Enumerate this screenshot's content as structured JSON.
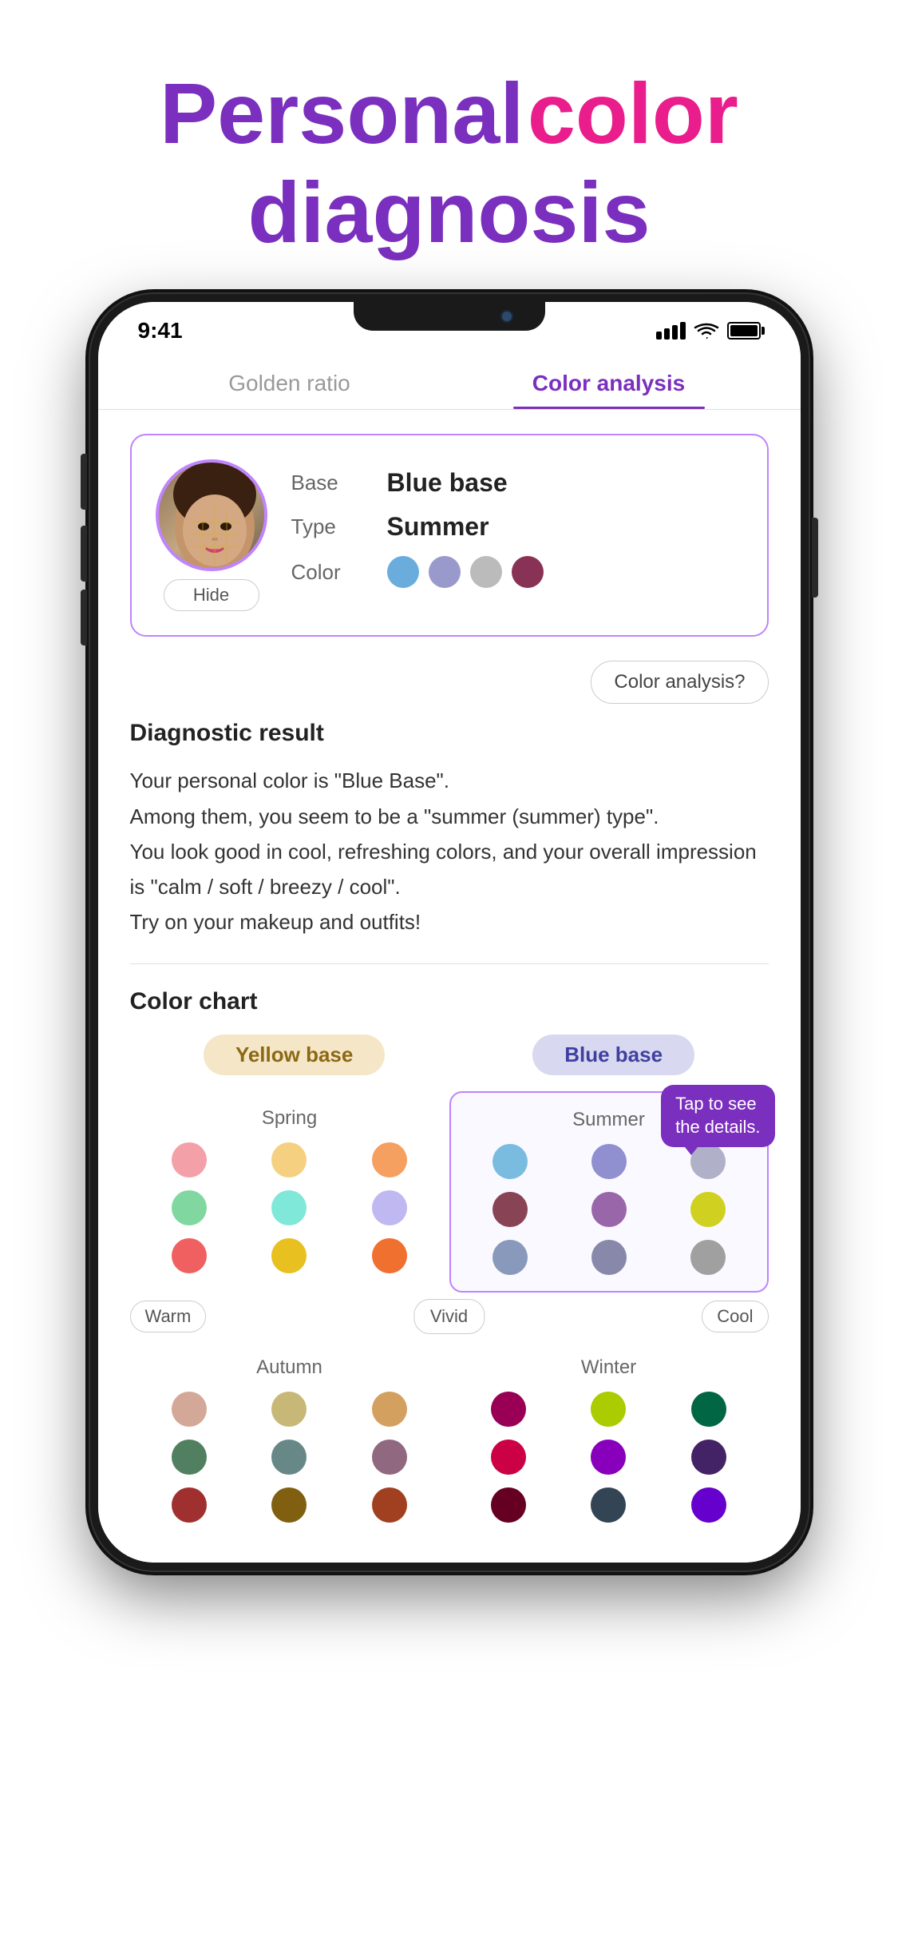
{
  "page": {
    "title_line1_word1": "Personal",
    "title_line1_word2": "color",
    "title_line2": "diagnosis"
  },
  "phone": {
    "status_bar": {
      "time": "9:41",
      "battery_label": "Battery"
    },
    "tabs": [
      {
        "id": "golden-ratio",
        "label": "Golden ratio",
        "active": false
      },
      {
        "id": "color-analysis",
        "label": "Color analysis",
        "active": true
      }
    ],
    "profile_card": {
      "base_label": "Base",
      "base_value": "Blue base",
      "type_label": "Type",
      "type_value": "Summer",
      "color_label": "Color",
      "hide_button": "Hide",
      "colors": [
        {
          "hex": "#6AADDC",
          "name": "sky-blue"
        },
        {
          "hex": "#9999CC",
          "name": "lavender"
        },
        {
          "hex": "#BBBBBB",
          "name": "silver-gray"
        },
        {
          "hex": "#883355",
          "name": "mauve"
        }
      ]
    },
    "color_analysis_button": "Color analysis?",
    "diagnostic": {
      "section_title": "Diagnostic result",
      "text": "Your personal color is \"Blue Base\".\nAmong them, you seem to be a \"summer (summer) type\".\nYou look good in cool, refreshing colors, and your overall impression is \"calm / soft / breezy / cool\".\nTry on your makeup and outfits!"
    },
    "color_chart": {
      "section_title": "Color chart",
      "base_labels": {
        "yellow": "Yellow base",
        "blue": "Blue base"
      },
      "vivid_label": "Vivid",
      "warm_label": "Warm",
      "cool_label": "Cool",
      "tap_tooltip": "Tap to see\nthe details.",
      "quadrants": {
        "spring": {
          "label": "Spring",
          "colors": [
            "#F4A0A8",
            "#F5D080",
            "#F5A060",
            "#80D8A0",
            "#80E8D8",
            "#C0B8F0",
            "#F06060",
            "#E8C020",
            "#F07030"
          ]
        },
        "summer": {
          "label": "Summer",
          "highlighted": true,
          "colors": [
            "#7ABCE0",
            "#9090D0",
            "#B0B0C0",
            "#884455",
            "#9966AA",
            "#D0D020",
            "#8899BB",
            "#8888AA",
            "#A0A0A0"
          ]
        },
        "autumn": {
          "label": "Autumn",
          "colors": [
            "#D4A898",
            "#C8B878",
            "#D4A060",
            "#508060",
            "#688888",
            "#906880",
            "#A03030",
            "#806010",
            "#A04020"
          ]
        },
        "winter": {
          "label": "Winter",
          "colors": [
            "#990055",
            "#AACC00",
            "#006644",
            "#CC0044",
            "#8800BB",
            "#442266",
            "#660022",
            "#334455",
            "#6600CC"
          ]
        }
      }
    }
  }
}
